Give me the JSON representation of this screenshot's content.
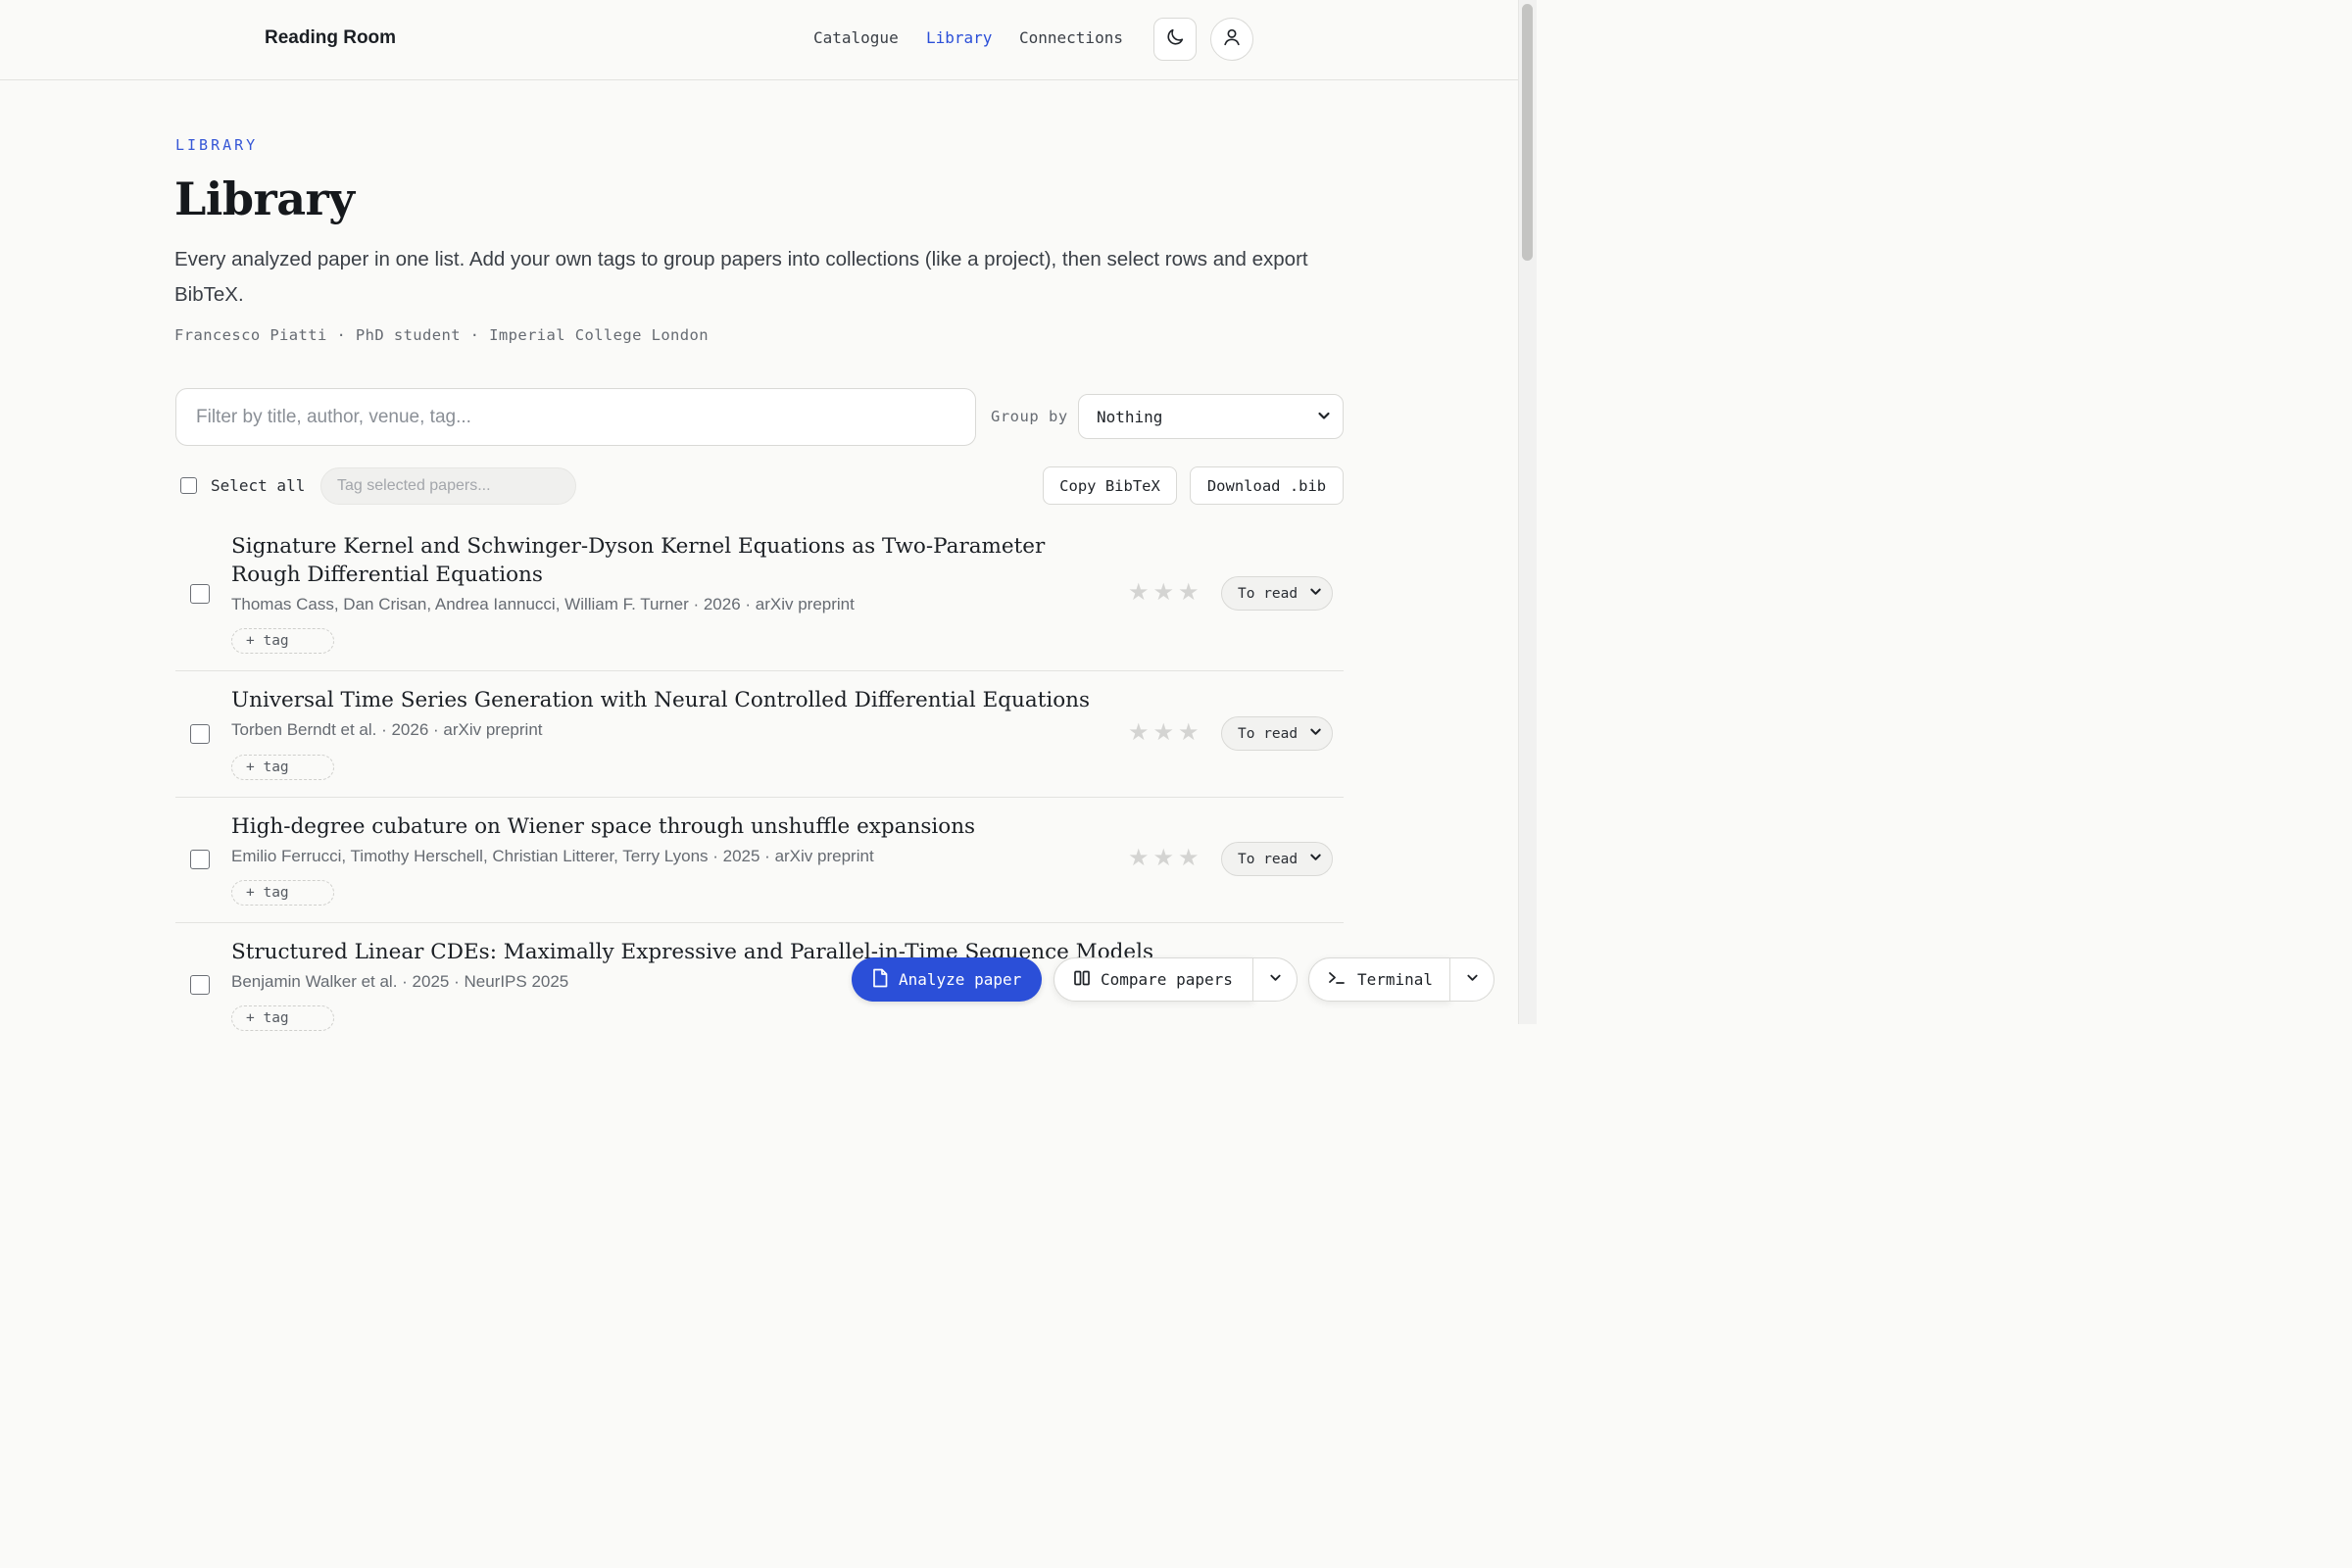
{
  "header": {
    "brand": "Reading Room",
    "nav": [
      "Catalogue",
      "Library",
      "Connections"
    ],
    "active_nav": "Library",
    "theme_icon": "moon-icon",
    "account_icon": "user-icon"
  },
  "page": {
    "eyebrow": "LIBRARY",
    "title": "Library",
    "intro": "Every analyzed paper in one list. Add your own tags to group papers into collections (like a project), then select rows and export BibTeX.",
    "byline": "Francesco Piatti · PhD student · Imperial College London"
  },
  "controls": {
    "filter_placeholder": "Filter by title, author, venue, tag...",
    "group_by_label": "Group by",
    "group_by_value": "Nothing",
    "select_all_label": "Select all",
    "tag_placeholder": "Tag selected papers...",
    "copy_bibtex": "Copy BibTeX",
    "download_bib": "Download .bib"
  },
  "papers": [
    {
      "title": "Signature Kernel and Schwinger-Dyson Kernel Equations as Two-Parameter Rough Differential Equations",
      "meta": "Thomas Cass, Dan Crisan, Andrea Iannucci, William F. Turner · 2026 · arXiv preprint",
      "tag_button": "+ tag",
      "stars": "★★★",
      "rating": 0,
      "status": "To read"
    },
    {
      "title": "Universal Time Series Generation with Neural Controlled Differential Equations",
      "meta": "Torben Berndt et al. · 2026 · arXiv preprint",
      "tag_button": "+ tag",
      "stars": "★★★",
      "rating": 0,
      "status": "To read"
    },
    {
      "title": "High-degree cubature on Wiener space through unshuffle expansions",
      "meta": "Emilio Ferrucci, Timothy Herschell, Christian Litterer, Terry Lyons · 2025 · arXiv preprint",
      "tag_button": "+ tag",
      "stars": "★★★",
      "rating": 0,
      "status": "To read"
    },
    {
      "title": "Structured Linear CDEs: Maximally Expressive and Parallel-in-Time Sequence Models",
      "meta": "Benjamin Walker et al. · 2025 · NeurIPS 2025",
      "tag_button": "+ tag",
      "stars": "★★★",
      "rating": 0,
      "status": "To read"
    }
  ],
  "dock": {
    "analyze": "Analyze paper",
    "compare": "Compare papers",
    "terminal": "Terminal"
  },
  "colors": {
    "accent": "#2b4fd8",
    "background": "#fafaf8"
  }
}
